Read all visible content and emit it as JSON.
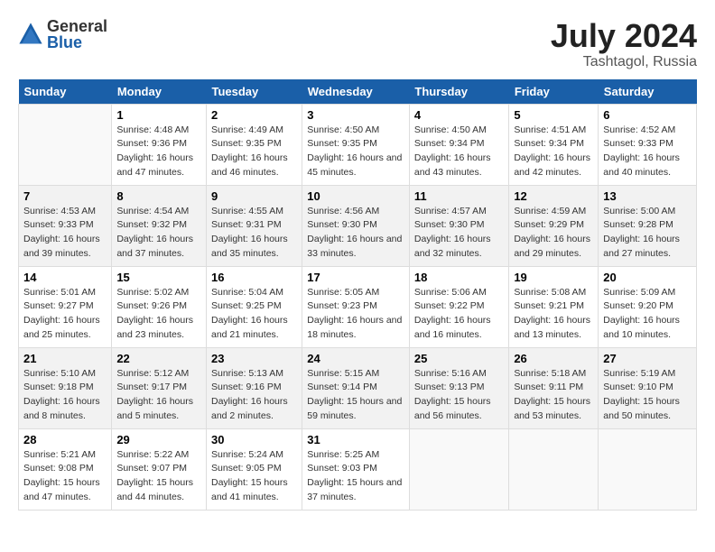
{
  "logo": {
    "general": "General",
    "blue": "Blue"
  },
  "title": {
    "month_year": "July 2024",
    "location": "Tashtagol, Russia"
  },
  "weekdays": [
    "Sunday",
    "Monday",
    "Tuesday",
    "Wednesday",
    "Thursday",
    "Friday",
    "Saturday"
  ],
  "weeks": [
    [
      {
        "day": "",
        "sunrise": "",
        "sunset": "",
        "daylight": ""
      },
      {
        "day": "1",
        "sunrise": "Sunrise: 4:48 AM",
        "sunset": "Sunset: 9:36 PM",
        "daylight": "Daylight: 16 hours and 47 minutes."
      },
      {
        "day": "2",
        "sunrise": "Sunrise: 4:49 AM",
        "sunset": "Sunset: 9:35 PM",
        "daylight": "Daylight: 16 hours and 46 minutes."
      },
      {
        "day": "3",
        "sunrise": "Sunrise: 4:50 AM",
        "sunset": "Sunset: 9:35 PM",
        "daylight": "Daylight: 16 hours and 45 minutes."
      },
      {
        "day": "4",
        "sunrise": "Sunrise: 4:50 AM",
        "sunset": "Sunset: 9:34 PM",
        "daylight": "Daylight: 16 hours and 43 minutes."
      },
      {
        "day": "5",
        "sunrise": "Sunrise: 4:51 AM",
        "sunset": "Sunset: 9:34 PM",
        "daylight": "Daylight: 16 hours and 42 minutes."
      },
      {
        "day": "6",
        "sunrise": "Sunrise: 4:52 AM",
        "sunset": "Sunset: 9:33 PM",
        "daylight": "Daylight: 16 hours and 40 minutes."
      }
    ],
    [
      {
        "day": "7",
        "sunrise": "Sunrise: 4:53 AM",
        "sunset": "Sunset: 9:33 PM",
        "daylight": "Daylight: 16 hours and 39 minutes."
      },
      {
        "day": "8",
        "sunrise": "Sunrise: 4:54 AM",
        "sunset": "Sunset: 9:32 PM",
        "daylight": "Daylight: 16 hours and 37 minutes."
      },
      {
        "day": "9",
        "sunrise": "Sunrise: 4:55 AM",
        "sunset": "Sunset: 9:31 PM",
        "daylight": "Daylight: 16 hours and 35 minutes."
      },
      {
        "day": "10",
        "sunrise": "Sunrise: 4:56 AM",
        "sunset": "Sunset: 9:30 PM",
        "daylight": "Daylight: 16 hours and 33 minutes."
      },
      {
        "day": "11",
        "sunrise": "Sunrise: 4:57 AM",
        "sunset": "Sunset: 9:30 PM",
        "daylight": "Daylight: 16 hours and 32 minutes."
      },
      {
        "day": "12",
        "sunrise": "Sunrise: 4:59 AM",
        "sunset": "Sunset: 9:29 PM",
        "daylight": "Daylight: 16 hours and 29 minutes."
      },
      {
        "day": "13",
        "sunrise": "Sunrise: 5:00 AM",
        "sunset": "Sunset: 9:28 PM",
        "daylight": "Daylight: 16 hours and 27 minutes."
      }
    ],
    [
      {
        "day": "14",
        "sunrise": "Sunrise: 5:01 AM",
        "sunset": "Sunset: 9:27 PM",
        "daylight": "Daylight: 16 hours and 25 minutes."
      },
      {
        "day": "15",
        "sunrise": "Sunrise: 5:02 AM",
        "sunset": "Sunset: 9:26 PM",
        "daylight": "Daylight: 16 hours and 23 minutes."
      },
      {
        "day": "16",
        "sunrise": "Sunrise: 5:04 AM",
        "sunset": "Sunset: 9:25 PM",
        "daylight": "Daylight: 16 hours and 21 minutes."
      },
      {
        "day": "17",
        "sunrise": "Sunrise: 5:05 AM",
        "sunset": "Sunset: 9:23 PM",
        "daylight": "Daylight: 16 hours and 18 minutes."
      },
      {
        "day": "18",
        "sunrise": "Sunrise: 5:06 AM",
        "sunset": "Sunset: 9:22 PM",
        "daylight": "Daylight: 16 hours and 16 minutes."
      },
      {
        "day": "19",
        "sunrise": "Sunrise: 5:08 AM",
        "sunset": "Sunset: 9:21 PM",
        "daylight": "Daylight: 16 hours and 13 minutes."
      },
      {
        "day": "20",
        "sunrise": "Sunrise: 5:09 AM",
        "sunset": "Sunset: 9:20 PM",
        "daylight": "Daylight: 16 hours and 10 minutes."
      }
    ],
    [
      {
        "day": "21",
        "sunrise": "Sunrise: 5:10 AM",
        "sunset": "Sunset: 9:18 PM",
        "daylight": "Daylight: 16 hours and 8 minutes."
      },
      {
        "day": "22",
        "sunrise": "Sunrise: 5:12 AM",
        "sunset": "Sunset: 9:17 PM",
        "daylight": "Daylight: 16 hours and 5 minutes."
      },
      {
        "day": "23",
        "sunrise": "Sunrise: 5:13 AM",
        "sunset": "Sunset: 9:16 PM",
        "daylight": "Daylight: 16 hours and 2 minutes."
      },
      {
        "day": "24",
        "sunrise": "Sunrise: 5:15 AM",
        "sunset": "Sunset: 9:14 PM",
        "daylight": "Daylight: 15 hours and 59 minutes."
      },
      {
        "day": "25",
        "sunrise": "Sunrise: 5:16 AM",
        "sunset": "Sunset: 9:13 PM",
        "daylight": "Daylight: 15 hours and 56 minutes."
      },
      {
        "day": "26",
        "sunrise": "Sunrise: 5:18 AM",
        "sunset": "Sunset: 9:11 PM",
        "daylight": "Daylight: 15 hours and 53 minutes."
      },
      {
        "day": "27",
        "sunrise": "Sunrise: 5:19 AM",
        "sunset": "Sunset: 9:10 PM",
        "daylight": "Daylight: 15 hours and 50 minutes."
      }
    ],
    [
      {
        "day": "28",
        "sunrise": "Sunrise: 5:21 AM",
        "sunset": "Sunset: 9:08 PM",
        "daylight": "Daylight: 15 hours and 47 minutes."
      },
      {
        "day": "29",
        "sunrise": "Sunrise: 5:22 AM",
        "sunset": "Sunset: 9:07 PM",
        "daylight": "Daylight: 15 hours and 44 minutes."
      },
      {
        "day": "30",
        "sunrise": "Sunrise: 5:24 AM",
        "sunset": "Sunset: 9:05 PM",
        "daylight": "Daylight: 15 hours and 41 minutes."
      },
      {
        "day": "31",
        "sunrise": "Sunrise: 5:25 AM",
        "sunset": "Sunset: 9:03 PM",
        "daylight": "Daylight: 15 hours and 37 minutes."
      },
      {
        "day": "",
        "sunrise": "",
        "sunset": "",
        "daylight": ""
      },
      {
        "day": "",
        "sunrise": "",
        "sunset": "",
        "daylight": ""
      },
      {
        "day": "",
        "sunrise": "",
        "sunset": "",
        "daylight": ""
      }
    ]
  ]
}
